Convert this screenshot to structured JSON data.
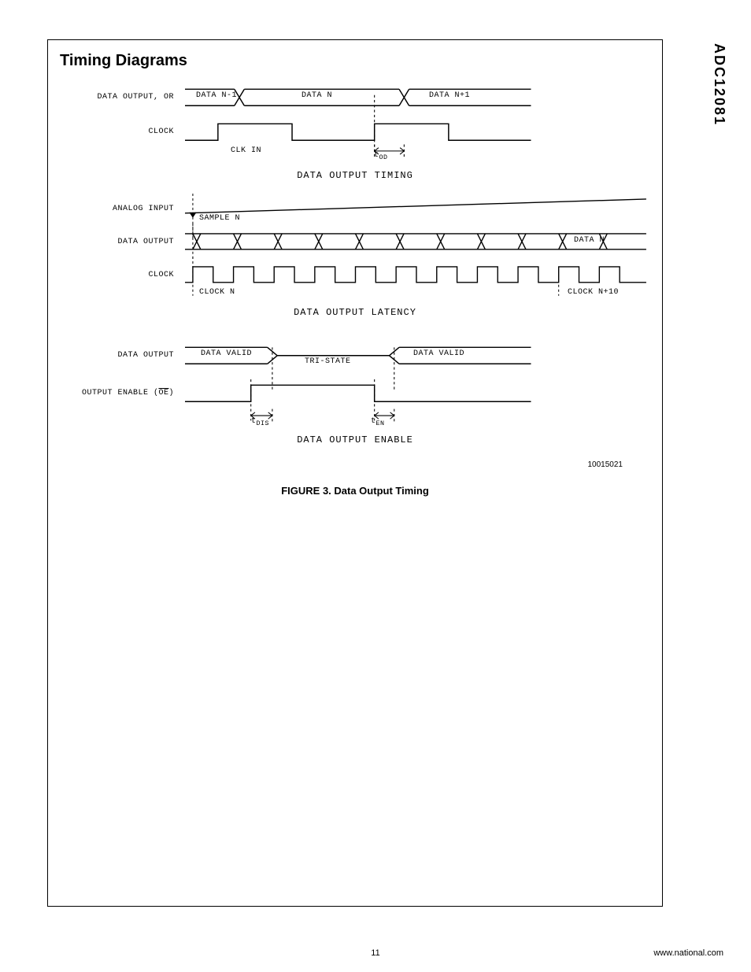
{
  "side_label": "ADC12081",
  "section_title": "Timing Diagrams",
  "figure_caption": "FIGURE 3. Data Output Timing",
  "image_id": "10015021",
  "page_number": "11",
  "footer_url": "www.national.com",
  "section1": {
    "title": "DATA OUTPUT TIMING",
    "signals": {
      "data_out": {
        "label": "DATA OUTPUT, OR",
        "segments": [
          "DATA N-1",
          "DATA N",
          "DATA N+1"
        ]
      },
      "clock": {
        "label": "CLOCK",
        "sub": "CLK IN"
      },
      "timing": {
        "t_od": "t",
        "t_od_sub": "OD"
      }
    }
  },
  "section2": {
    "title": "DATA OUTPUT LATENCY",
    "signals": {
      "analog": {
        "label": "ANALOG INPUT",
        "sub": "SAMPLE N"
      },
      "data_out": {
        "label": "DATA OUTPUT",
        "last": "DATA N"
      },
      "clock": {
        "label": "CLOCK",
        "sub_left": "CLOCK N",
        "sub_right": "CLOCK N+10"
      }
    }
  },
  "section3": {
    "title": "DATA OUTPUT ENABLE",
    "signals": {
      "data_out": {
        "label": "DATA OUTPUT",
        "valid": "DATA VALID",
        "tri": "TRI-STATE"
      },
      "oe": {
        "label_prefix": "OUTPUT ENABLE (",
        "label_bar": "OE",
        "label_suffix": ")"
      },
      "timing": {
        "t": "t",
        "dis": "DIS",
        "en": "EN"
      }
    }
  }
}
